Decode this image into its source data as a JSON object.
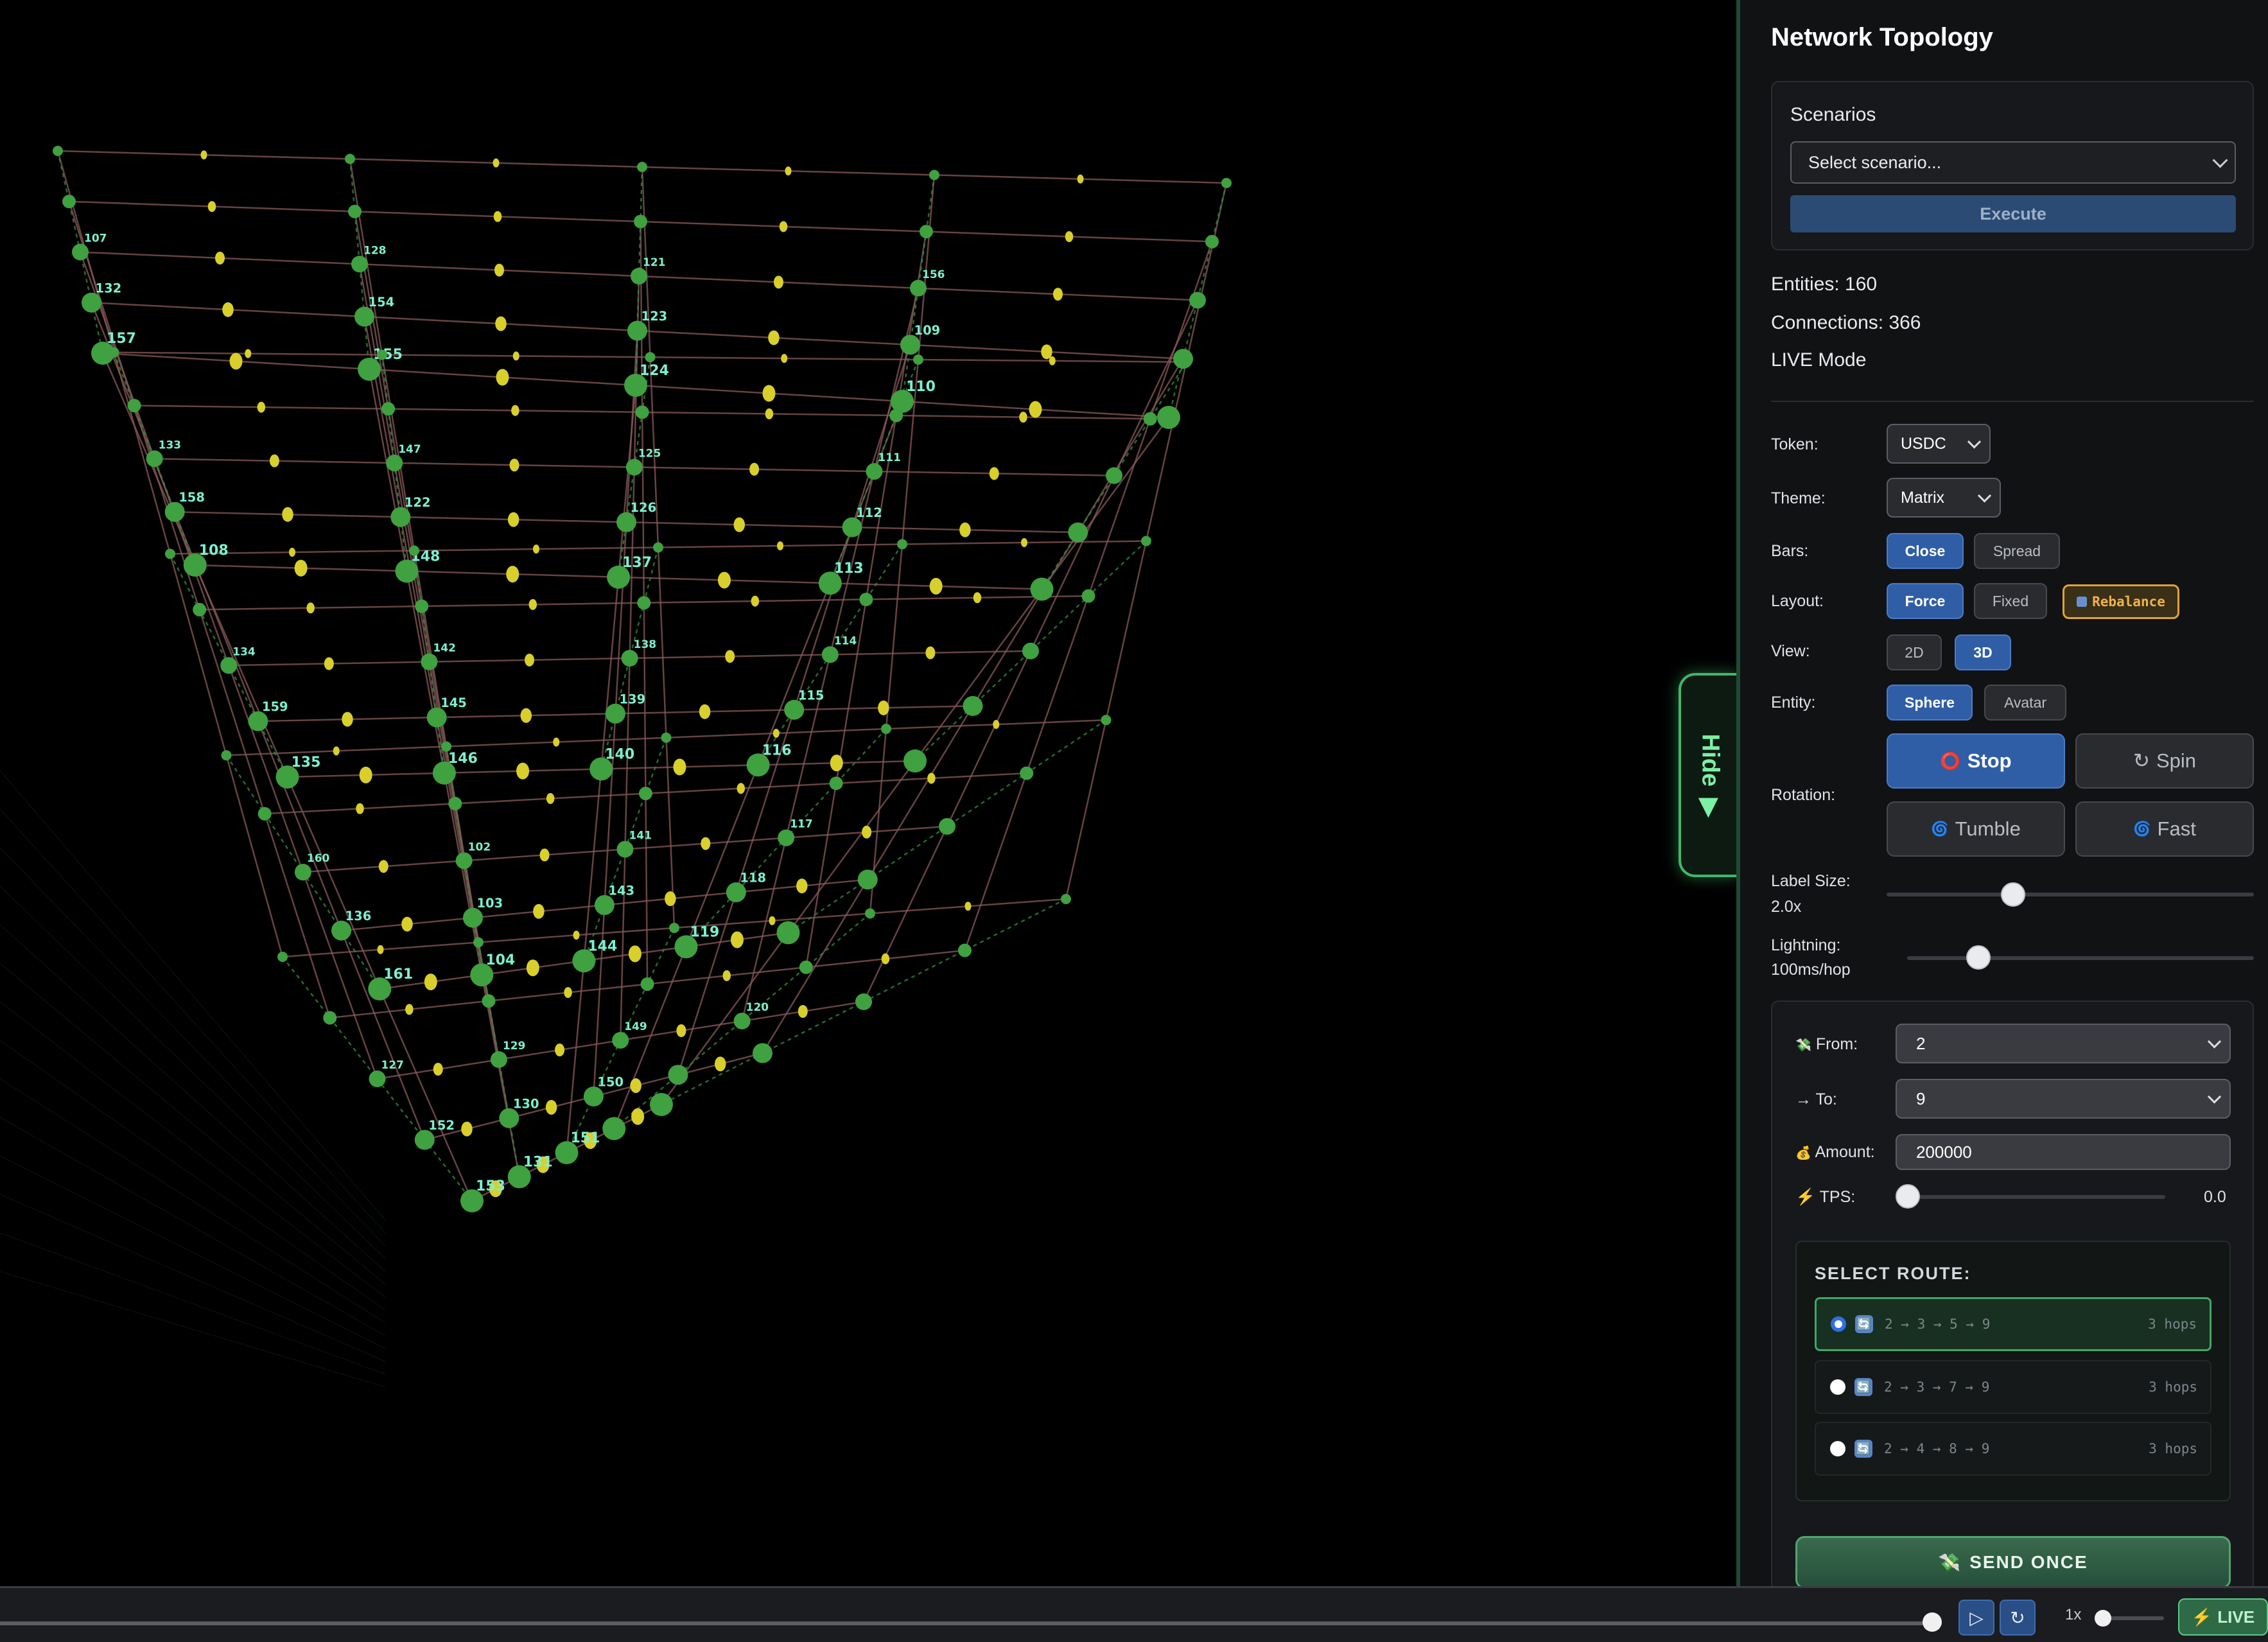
{
  "sidebar": {
    "title": "Network Topology",
    "scenarios": {
      "title": "Scenarios",
      "select_value": "Select scenario...",
      "execute_label": "Execute"
    },
    "stats": {
      "entities": "Entities: 160",
      "connections": "Connections: 366",
      "mode": "LIVE Mode"
    },
    "token": {
      "label": "Token:",
      "value": "USDC"
    },
    "theme": {
      "label": "Theme:",
      "value": "Matrix"
    },
    "bars": {
      "label": "Bars:",
      "options": [
        "Close",
        "Spread"
      ],
      "active": "Close"
    },
    "layout": {
      "label": "Layout:",
      "options": [
        "Force",
        "Fixed"
      ],
      "active": "Force",
      "rebalance_label": "Rebalance"
    },
    "view": {
      "label": "View:",
      "options": [
        "2D",
        "3D"
      ],
      "active": "3D"
    },
    "entity": {
      "label": "Entity:",
      "options": [
        "Sphere",
        "Avatar"
      ],
      "active": "Sphere"
    },
    "rotation": {
      "label": "Rotation:",
      "stop": {
        "icon": "⭕",
        "label": "Stop"
      },
      "spin": {
        "icon": "↻",
        "label": "Spin"
      },
      "tumble": {
        "icon": "🌀",
        "label": "Tumble"
      },
      "fast": {
        "icon": "🌀",
        "label": "Fast"
      },
      "active": "Stop"
    },
    "label_size": {
      "label": "Label Size:",
      "value": "2.0x"
    },
    "lightning": {
      "label": "Lightning:",
      "value": "100ms/hop"
    },
    "transaction": {
      "from": {
        "icon": "💸",
        "label": "From:",
        "value": "2"
      },
      "to": {
        "icon": "→",
        "label": "To:",
        "value": "9"
      },
      "amount": {
        "icon": "💰",
        "label": "Amount:",
        "value": "200000"
      },
      "tps": {
        "icon": "⚡",
        "label": "TPS:",
        "value": "0.0"
      },
      "route_title": "SELECT ROUTE:",
      "routes": [
        {
          "icon": "🔄",
          "path": "2 → 3 → 5 → 9",
          "hops": "3 hops",
          "selected": true
        },
        {
          "icon": "🔄",
          "path": "2 → 3 → 7 → 9",
          "hops": "3 hops",
          "selected": false
        },
        {
          "icon": "🔄",
          "path": "2 → 4 → 8 → 9",
          "hops": "3 hops",
          "selected": false
        }
      ],
      "send_icon": "💸",
      "send_label": "SEND ONCE"
    }
  },
  "hide_tab": {
    "label": "Hide",
    "icon": "▶"
  },
  "bottom_bar": {
    "play_icon": "▷",
    "reset_icon": "↻",
    "speed_label": "1x",
    "live_icon": "⚡",
    "live_label": "LIVE"
  },
  "scene": {
    "node_labels": [
      "107",
      "132",
      "157",
      "133",
      "158",
      "108",
      "134",
      "159",
      "135",
      "160",
      "136",
      "161",
      "127",
      "152",
      "153",
      "128",
      "154",
      "155",
      "147",
      "122",
      "148",
      "142",
      "145",
      "146",
      "102",
      "103",
      "104",
      "129",
      "130",
      "131",
      "121",
      "123",
      "124",
      "125",
      "126",
      "137",
      "138",
      "139",
      "140",
      "141",
      "143",
      "144",
      "149",
      "150",
      "151",
      "156",
      "109",
      "110",
      "111",
      "112",
      "113",
      "114",
      "115",
      "116",
      "117",
      "118",
      "119",
      "120"
    ],
    "colors": {
      "node": "#3fa13f",
      "node_highlight": "#d8cf2c",
      "edge": "#8a5a5a",
      "grid": "#1e5a2c",
      "label": "#7cf0d0"
    }
  }
}
